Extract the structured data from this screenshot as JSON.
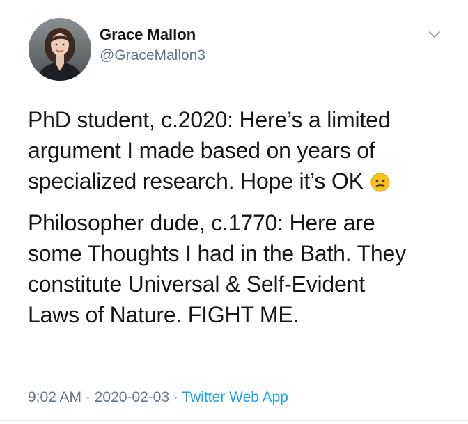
{
  "tweet": {
    "author": {
      "display_name": "Grace Mallon",
      "handle": "@GraceMallon3"
    },
    "paragraphs": [
      {
        "lines": [
          "PhD student, c.2020: Here’s a limited",
          "argument I made based on years of",
          "specialized research. Hope it’s OK"
        ],
        "trailing_emoji": "confused-face-emoji"
      },
      {
        "lines": [
          "Philosopher dude, c.1770: Here are",
          "some Thoughts I had in the Bath. They",
          "constitute Universal & Self-Evident",
          "Laws of Nature. FIGHT ME."
        ]
      }
    ],
    "meta": {
      "time": "9:02 AM",
      "separator": " · ",
      "date": "2020-02-03",
      "source": "Twitter Web App"
    },
    "icons": {
      "menu": "chevron-down-icon",
      "avatar": "profile-photo"
    },
    "colors": {
      "text": "#14171a",
      "secondary": "#657786",
      "link": "#1da1f2"
    }
  }
}
